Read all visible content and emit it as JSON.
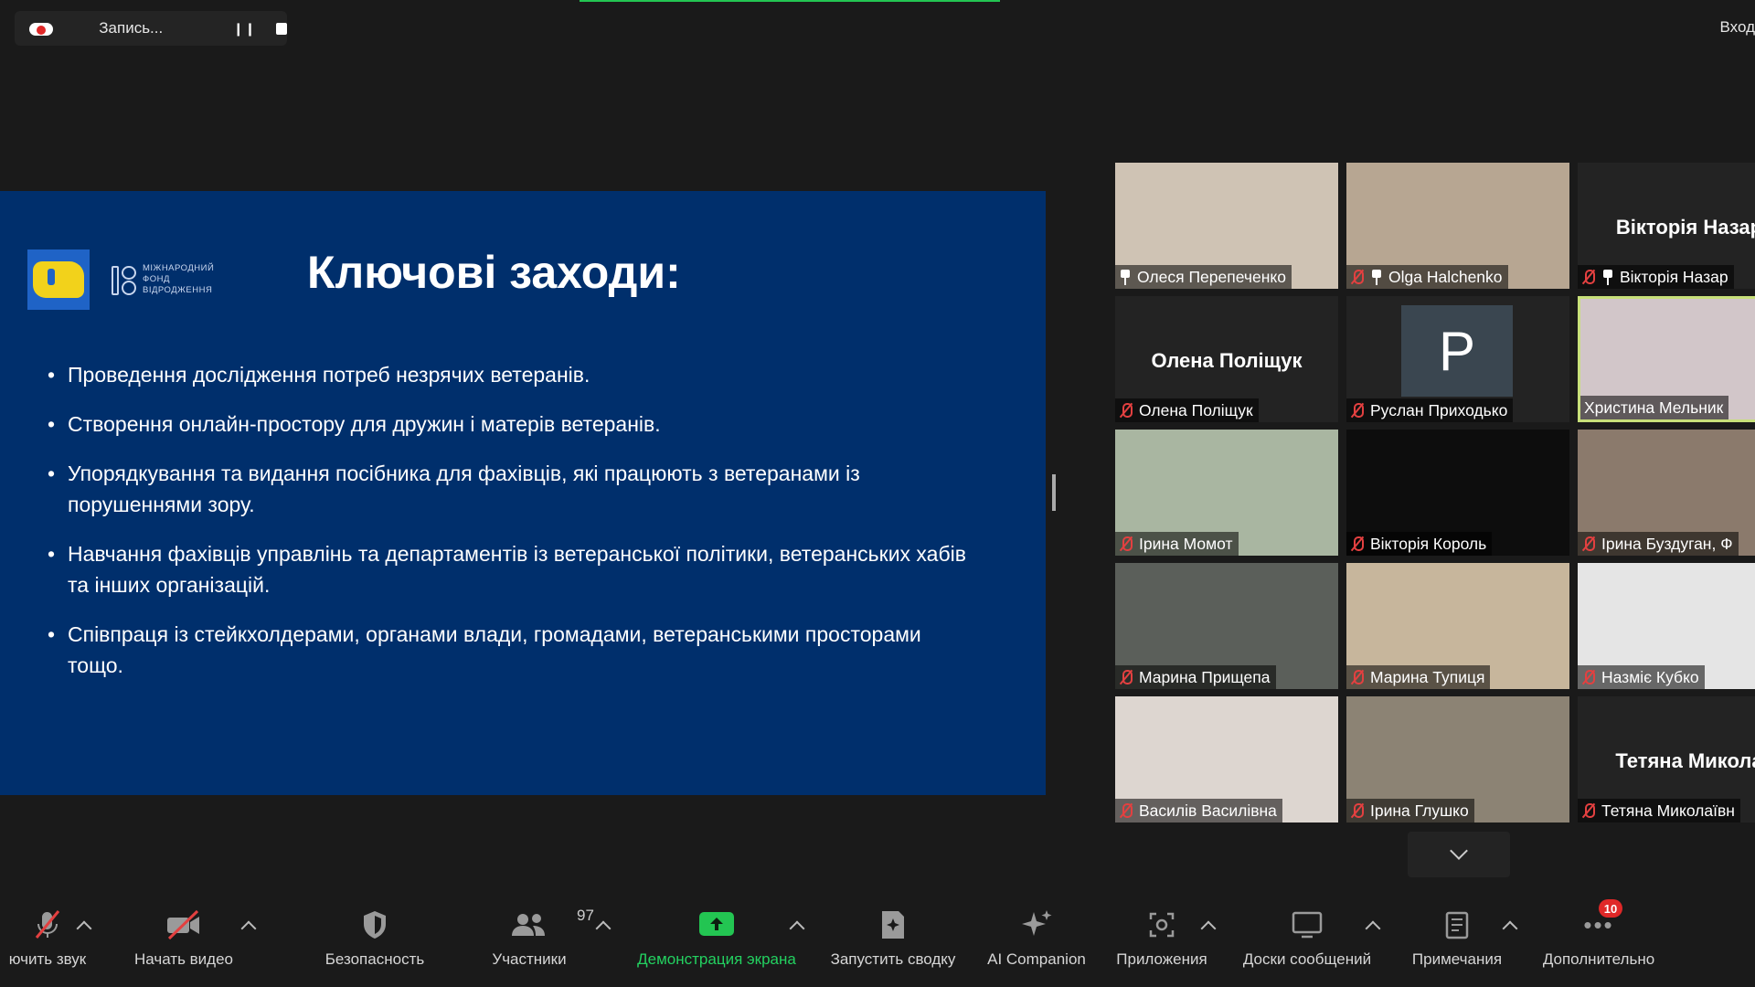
{
  "recording": {
    "label": "Запись..."
  },
  "top_right": {
    "enter_label": "Вход"
  },
  "slide": {
    "logo_text": [
      "МІЖНАРОДНИЙ",
      "ФОНД",
      "ВІДРОДЖЕННЯ"
    ],
    "title": "Ключові заходи:",
    "bullets": [
      "Проведення дослідження потреб незрячих ветеранів.",
      "Створення онлайн-простору для дружин і матерів ветеранів.",
      "Упорядкування та видання посібника для фахівців, які працюють з ветеранами із порушеннями зору.",
      "Навчання фахівців управлінь та департаментів із ветеранської політики, ветеранських хабів та інших організацій.",
      "Співпраця із стейкхолдерами, органами влади, громадами, ветеранськими просторами тощо."
    ]
  },
  "participants_tiles": [
    {
      "name": "Олеся Перепеченко",
      "muted": false,
      "pinned": true,
      "video": true,
      "bg": "#cfc3b4"
    },
    {
      "name": "Olga Halchenko",
      "muted": true,
      "pinned": true,
      "video": true,
      "bg": "#b7a692"
    },
    {
      "name": "Вікторія Назар",
      "big_name": "Вікторія Назар",
      "muted": true,
      "pinned": true,
      "video": false
    },
    {
      "name": "Олена Поліщук",
      "big_name": "Олена Поліщук",
      "muted": true,
      "pinned": false,
      "video": false
    },
    {
      "name": "Руслан Приходько",
      "avatar_letter": "P",
      "muted": true,
      "pinned": false,
      "video": false
    },
    {
      "name": "Христина Мельник",
      "muted": false,
      "pinned": false,
      "video": true,
      "active": true,
      "bg": "#d2c6c9"
    },
    {
      "name": "Ірина Момот",
      "muted": true,
      "pinned": false,
      "video": true,
      "bg": "#a9b6a1"
    },
    {
      "name": "Вікторія Король",
      "muted": true,
      "pinned": false,
      "video": true,
      "bg": "#0d0d0d"
    },
    {
      "name": "Ірина Буздуган, Ф",
      "muted": true,
      "pinned": false,
      "video": true,
      "bg": "#8b7a6c"
    },
    {
      "name": "Марина Прищепа",
      "muted": true,
      "pinned": false,
      "video": true,
      "bg": "#5b5f5a"
    },
    {
      "name": "Марина Тупиця",
      "muted": true,
      "pinned": false,
      "video": true,
      "bg": "#c7b69c"
    },
    {
      "name": "Назміє Кубко",
      "muted": true,
      "pinned": false,
      "video": true,
      "bg": "#e5e5e5"
    },
    {
      "name": "Василів Василівна",
      "muted": true,
      "pinned": false,
      "video": true,
      "bg": "#ddd6d0"
    },
    {
      "name": "Ірина Глушко",
      "muted": true,
      "pinned": false,
      "video": true,
      "bg": "#8c8374"
    },
    {
      "name": "Тетяна Миколаївн",
      "big_name": "Тетяна Микола",
      "muted": true,
      "pinned": false,
      "video": false
    }
  ],
  "toolbar": {
    "mute_label": "ючить звук",
    "video_label": "Начать видео",
    "security_label": "Безопасность",
    "participants_label": "Участники",
    "participants_count": "97",
    "share_label": "Демонстрация экрана",
    "summary_label": "Запустить сводку",
    "ai_label": "AI Companion",
    "apps_label": "Приложения",
    "boards_label": "Доски сообщений",
    "notes_label": "Примечания",
    "more_label": "Дополнительно",
    "more_badge": "10"
  },
  "colors": {
    "slide_bg": "#002f6c",
    "share_green": "#23d160",
    "mute_red": "#e34040",
    "active_border": "#c8e07a"
  }
}
